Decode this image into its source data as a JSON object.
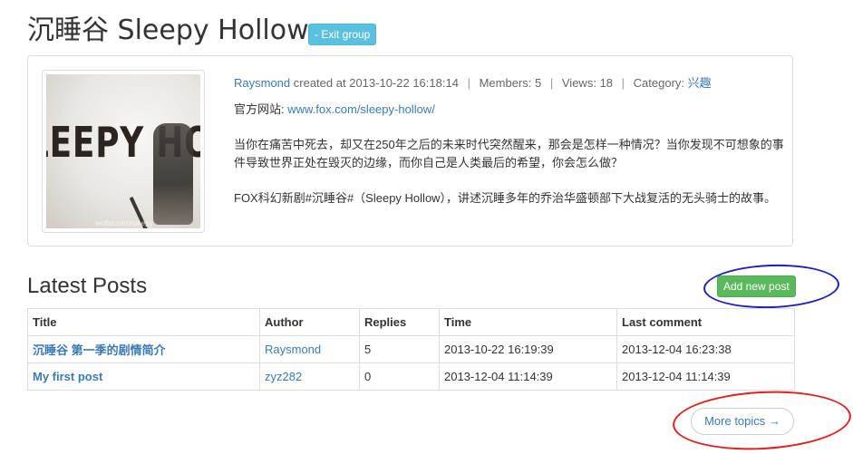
{
  "header": {
    "group_title": "沉睡谷 Sleepy Hollow",
    "exit_button": "- Exit group"
  },
  "info": {
    "creator": "Raysmond",
    "created_label": "created at",
    "created_at": "2013-10-22 16:18:14",
    "members_label": "Members:",
    "members": "5",
    "views_label": "Views:",
    "views": "18",
    "category_label": "Category:",
    "category": "兴趣",
    "site_label": "官方网站:",
    "site_url": "www.fox.com/sleepy-hollow/",
    "description1": "当你在痛苦中死去，却又在250年之后的未来时代突然醒来，那会是怎样一种情况？当你发现不可想象的事件导致世界正处在毁灭的边缘，而你自己是人类最后的希望，你会怎么做？",
    "description2": "FOX科幻新剧#沉睡谷#（Sleepy Hollow），讲述沉睡多年的乔治华盛顿部下大战复活的无头骑士的故事。",
    "poster_text": "LEEPY HOLL",
    "poster_watermark": "weibo.com/sleepy"
  },
  "posts": {
    "title": "Latest Posts",
    "add_button": "Add new post",
    "columns": [
      "Title",
      "Author",
      "Replies",
      "Time",
      "Last comment"
    ],
    "rows": [
      {
        "title": "沉睡谷 第一季的剧情简介",
        "author": "Raysmond",
        "replies": "5",
        "time": "2013-10-22 16:19:39",
        "last_comment": "2013-12-04 16:23:38"
      },
      {
        "title": "My first post",
        "author": "zyz282",
        "replies": "0",
        "time": "2013-12-04 11:14:39",
        "last_comment": "2013-12-04 11:14:39"
      }
    ],
    "more_button": "More topics →"
  },
  "annotations": {
    "blue_circle_color": "#1d1fbf",
    "red_circle_color": "#e02020"
  }
}
